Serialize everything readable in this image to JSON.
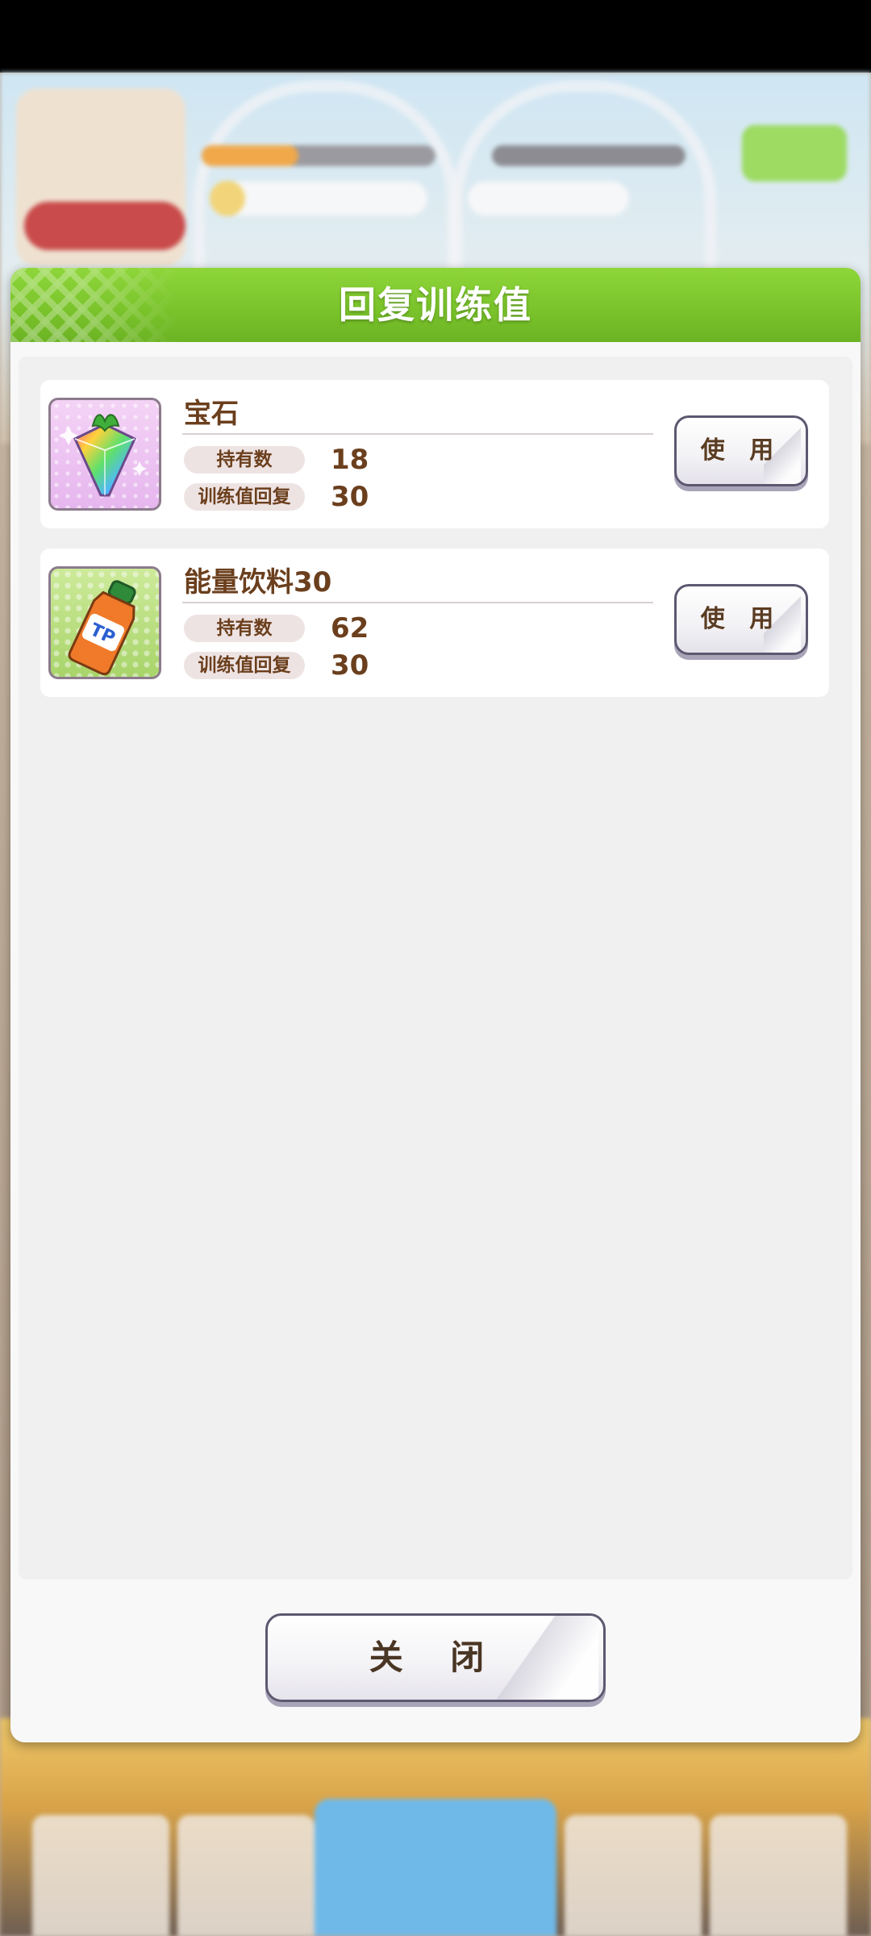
{
  "dialog": {
    "title": "回复训练值",
    "close_label": "关 闭"
  },
  "items": [
    {
      "name": "宝石",
      "icon": "rainbow-gem-icon",
      "owned_label": "持有数",
      "owned_value": "18",
      "recover_label": "训练值回复",
      "recover_value": "30",
      "use_label": "使 用"
    },
    {
      "name": "能量饮料30",
      "icon": "tp-energy-drink-icon",
      "icon_text": "TP",
      "owned_label": "持有数",
      "owned_value": "62",
      "recover_label": "训练值回复",
      "recover_value": "30",
      "use_label": "使 用"
    }
  ],
  "colors": {
    "header_green": "#79c22a",
    "text_brown": "#6b3f1d",
    "button_border": "#5d5870"
  }
}
